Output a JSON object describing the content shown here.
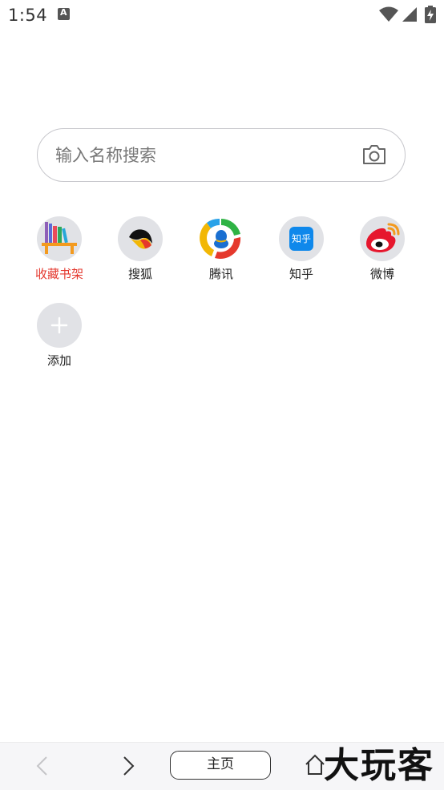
{
  "status_bar": {
    "time": "1:54"
  },
  "search": {
    "placeholder": "输入名称搜索"
  },
  "shortcuts": [
    {
      "label": "收藏书架",
      "icon": "bookshelf-icon"
    },
    {
      "label": "搜狐",
      "icon": "sohu-icon"
    },
    {
      "label": "腾讯",
      "icon": "tencent-icon"
    },
    {
      "label": "知乎",
      "icon": "zhihu-icon",
      "icon_text": "知乎"
    },
    {
      "label": "微博",
      "icon": "weibo-icon"
    },
    {
      "label": "添加",
      "icon": "add-icon"
    }
  ],
  "colors": {
    "accent_red": "#e4392f",
    "circle_bg": "#e1e2e6",
    "zhihu_blue": "#0f88eb"
  },
  "bottom_bar": {
    "home_label": "主页",
    "watermark": "大玩客"
  }
}
